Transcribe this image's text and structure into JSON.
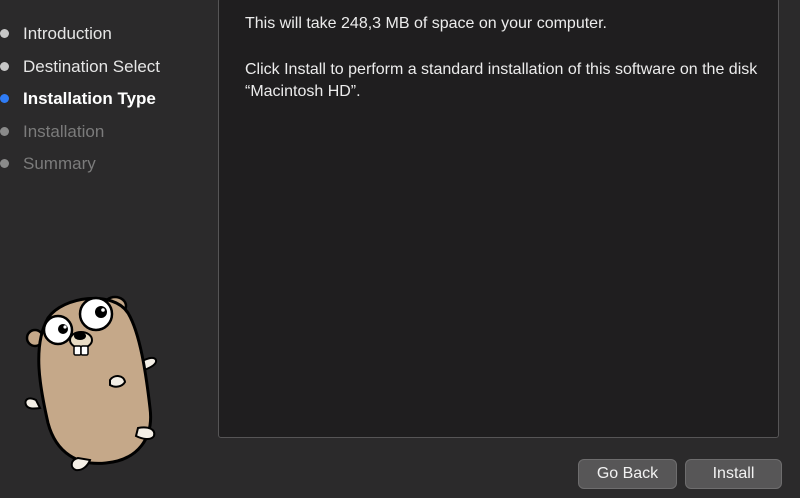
{
  "sidebar": {
    "steps": [
      {
        "label": "Introduction",
        "state": "done"
      },
      {
        "label": "Destination Select",
        "state": "done"
      },
      {
        "label": "Installation Type",
        "state": "current"
      },
      {
        "label": "Installation",
        "state": "pending"
      },
      {
        "label": "Summary",
        "state": "pending"
      }
    ]
  },
  "content": {
    "space_text": "This will take 248,3 MB of space on your computer.",
    "install_text": "Click Install to perform a standard installation of this software on the disk “Macintosh HD”."
  },
  "footer": {
    "back_label": "Go Back",
    "install_label": "Install"
  },
  "colors": {
    "accent": "#2f7cf6",
    "background": "#2b2a2b",
    "panel": "#1f1e1f",
    "gopher_body": "#c5a889"
  },
  "icons": {
    "mascot": "go-gopher-mascot"
  }
}
